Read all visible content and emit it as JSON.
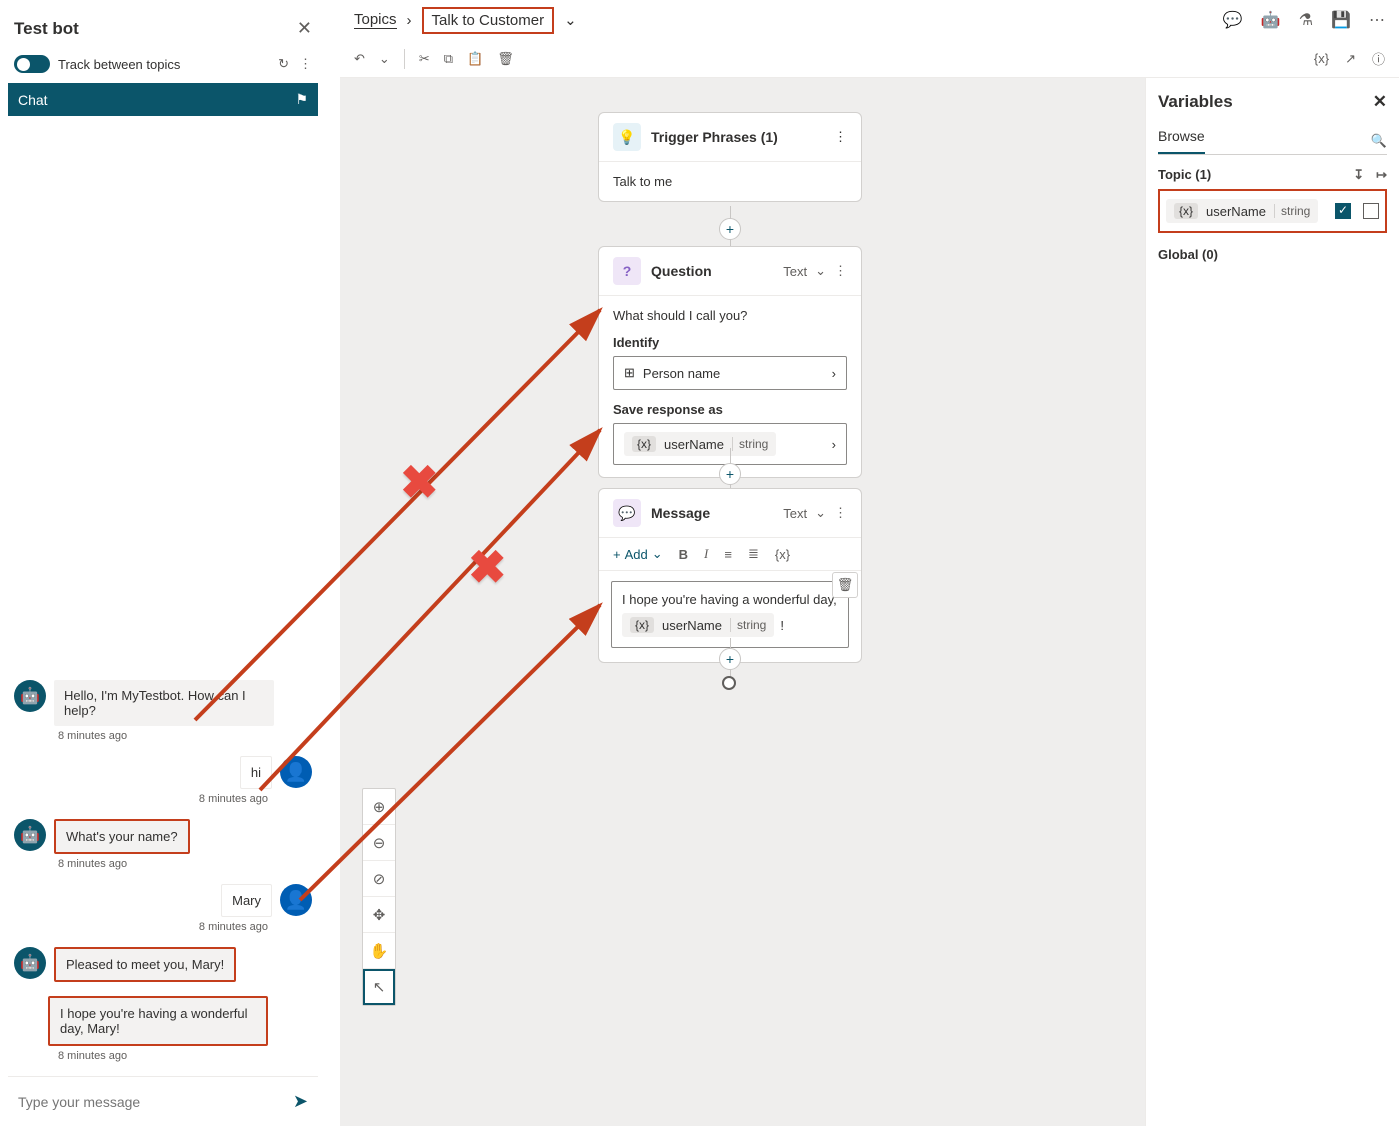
{
  "testPanel": {
    "title": "Test bot",
    "trackLabel": "Track between topics",
    "chatTab": "Chat",
    "messages": [
      {
        "from": "bot",
        "text": "Hello, I'm MyTestbot. How can I help?",
        "ts": "8 minutes ago",
        "hl": false
      },
      {
        "from": "user",
        "text": "hi",
        "ts": "8 minutes ago",
        "hl": true
      },
      {
        "from": "bot",
        "text": "What's your name?",
        "ts": "8 minutes ago",
        "hl": true
      },
      {
        "from": "user",
        "text": "Mary",
        "ts": "8 minutes ago",
        "hl": true
      },
      {
        "from": "bot",
        "text": "Pleased to meet you, Mary!",
        "ts": "",
        "hl": true
      },
      {
        "from": "bot",
        "text": "I hope you're having a wonderful day, Mary!",
        "ts": "8 minutes ago",
        "hl": true
      }
    ],
    "inputPlaceholder": "Type your message"
  },
  "breadcrumb": {
    "root": "Topics",
    "current": "Talk to Customer"
  },
  "nodes": {
    "trigger": {
      "title": "Trigger Phrases (1)",
      "phrase": "Talk to me"
    },
    "question": {
      "title": "Question",
      "type": "Text",
      "prompt": "What should I call you?",
      "identifyLabel": "Identify",
      "identifyValue": "Person name",
      "saveLabel": "Save response as",
      "varName": "userName",
      "varType": "string"
    },
    "message": {
      "title": "Message",
      "type": "Text",
      "addLabel": "Add",
      "text": "I hope you're having a wonderful day,",
      "exclaim": "!",
      "varName": "userName",
      "varType": "string"
    }
  },
  "varPanel": {
    "title": "Variables",
    "browseTab": "Browse",
    "topicSection": "Topic (1)",
    "globalSection": "Global (0)",
    "var": {
      "name": "userName",
      "type": "string"
    }
  }
}
